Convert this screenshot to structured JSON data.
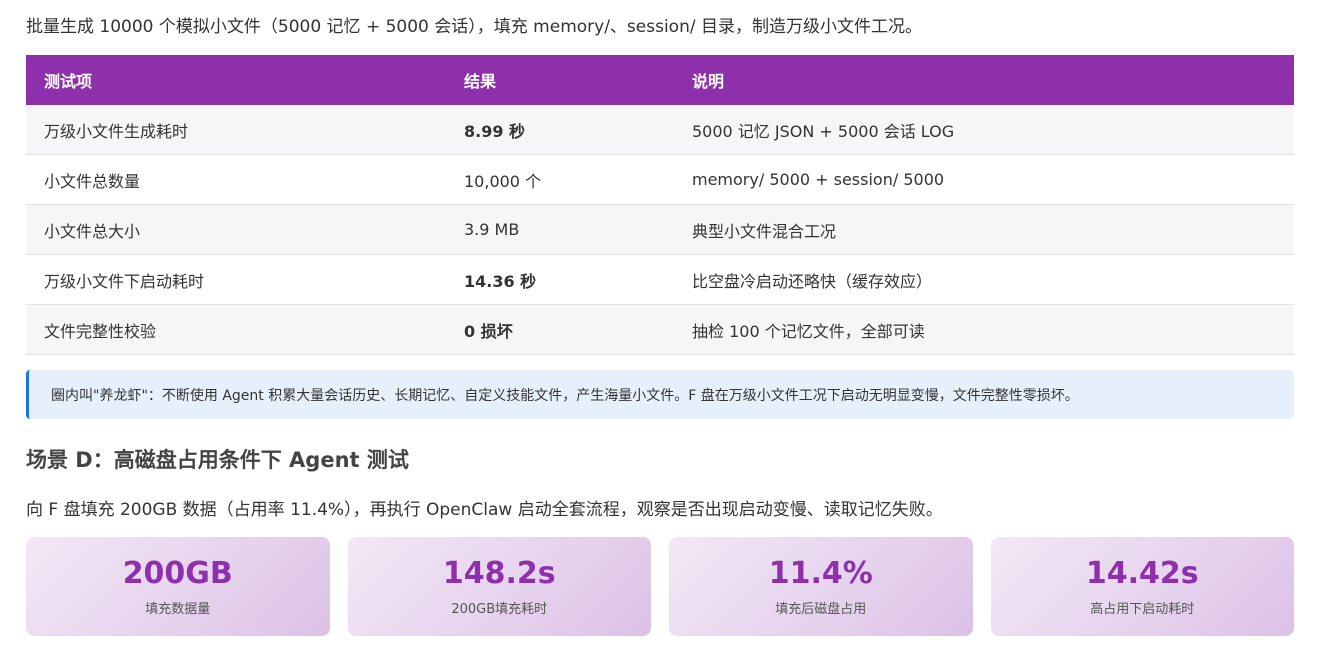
{
  "intro": "批量生成 10000 个模拟小文件（5000 记忆 + 5000 会话），填充 memory/、session/ 目录，制造万级小文件工况。",
  "table": {
    "headers": [
      "测试项",
      "结果",
      "说明"
    ],
    "rows": [
      {
        "item": "万级小文件生成耗时",
        "result": "8.99 秒",
        "note": "5000 记忆 JSON + 5000 会话 LOG"
      },
      {
        "item": "小文件总数量",
        "result": "10,000 个",
        "note": "memory/ 5000 + session/ 5000"
      },
      {
        "item": "小文件总大小",
        "result": "3.9 MB",
        "note": "典型小文件混合工况"
      },
      {
        "item": "万级小文件下启动耗时",
        "result": "14.36 秒",
        "note": "比空盘冷启动还略快（缓存效应）"
      },
      {
        "item": "文件完整性校验",
        "result": "0 损坏",
        "note": "抽检 100 个记忆文件，全部可读"
      }
    ]
  },
  "callout": "圈内叫\"养龙虾\"：不断使用 Agent 积累大量会话历史、长期记忆、自定义技能文件，产生海量小文件。F 盘在万级小文件工况下启动无明显变慢，文件完整性零损坏。",
  "section": {
    "heading": "场景 D：高磁盘占用条件下 Agent 测试",
    "description": "向 F 盘填充 200GB 数据（占用率 11.4%），再执行 OpenClaw 启动全套流程，观察是否出现启动变慢、读取记忆失败。"
  },
  "cards": [
    {
      "value": "200GB",
      "label": "填充数据量"
    },
    {
      "value": "148.2s",
      "label": "200GB填充耗时"
    },
    {
      "value": "11.4%",
      "label": "填充后磁盘占用"
    },
    {
      "value": "14.42s",
      "label": "高占用下启动耗时"
    }
  ],
  "colors": {
    "header_bg": "#8e2fab",
    "accent_purple": "#8e2fab",
    "accent_green": "#1e6b2e",
    "callout_border": "#1a73e8",
    "callout_bg": "#e6f0fb"
  }
}
